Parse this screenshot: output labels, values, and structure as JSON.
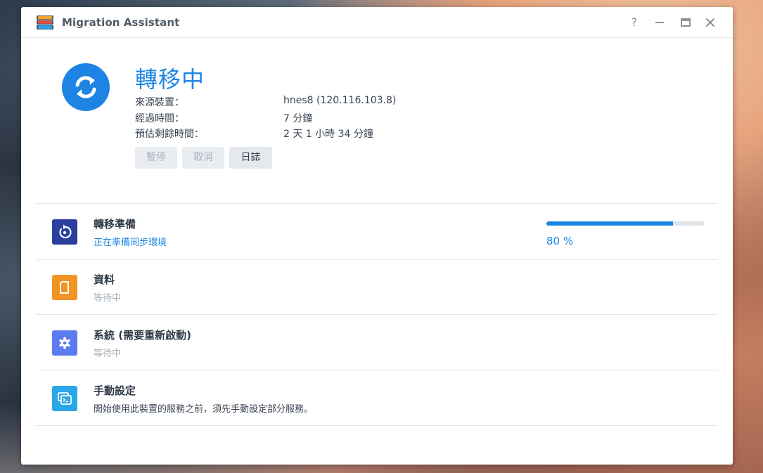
{
  "window": {
    "title": "Migration Assistant",
    "help": "?",
    "minimize": "—",
    "maximize": "▭",
    "close": "✕"
  },
  "status": {
    "title": "轉移中",
    "rows": [
      {
        "label": "來源裝置：",
        "value": "hnes8 (120.116.103.8)"
      },
      {
        "label": "經過時間：",
        "value": "7 分鐘"
      },
      {
        "label": "預估剩餘時間：",
        "value": "2 天 1 小時 34 分鐘"
      }
    ],
    "buttons": {
      "pause": "暫停",
      "cancel": "取消",
      "log": "日誌"
    }
  },
  "tasks": [
    {
      "title": "轉移準備",
      "subtitle": "正在準備同步環境",
      "icon": "refresh-circle-icon",
      "color": "#2b3f9e",
      "sub_color": "#1d84e6",
      "progress": 80,
      "progress_label": "80 %"
    },
    {
      "title": "資料",
      "subtitle": "等待中",
      "icon": "document-icon",
      "color": "#f39323",
      "sub_color": "#a7b0b9"
    },
    {
      "title": "系統 (需要重新啟動)",
      "subtitle": "等待中",
      "icon": "gear-icon",
      "color": "#5b7bef",
      "sub_color": "#a7b0b9"
    },
    {
      "title": "手動設定",
      "subtitle": "開始使用此裝置的服務之前，須先手動設定部分服務。",
      "icon": "terminal-window-icon",
      "color": "#2aa7e8",
      "sub_color": "#3a4552"
    }
  ]
}
